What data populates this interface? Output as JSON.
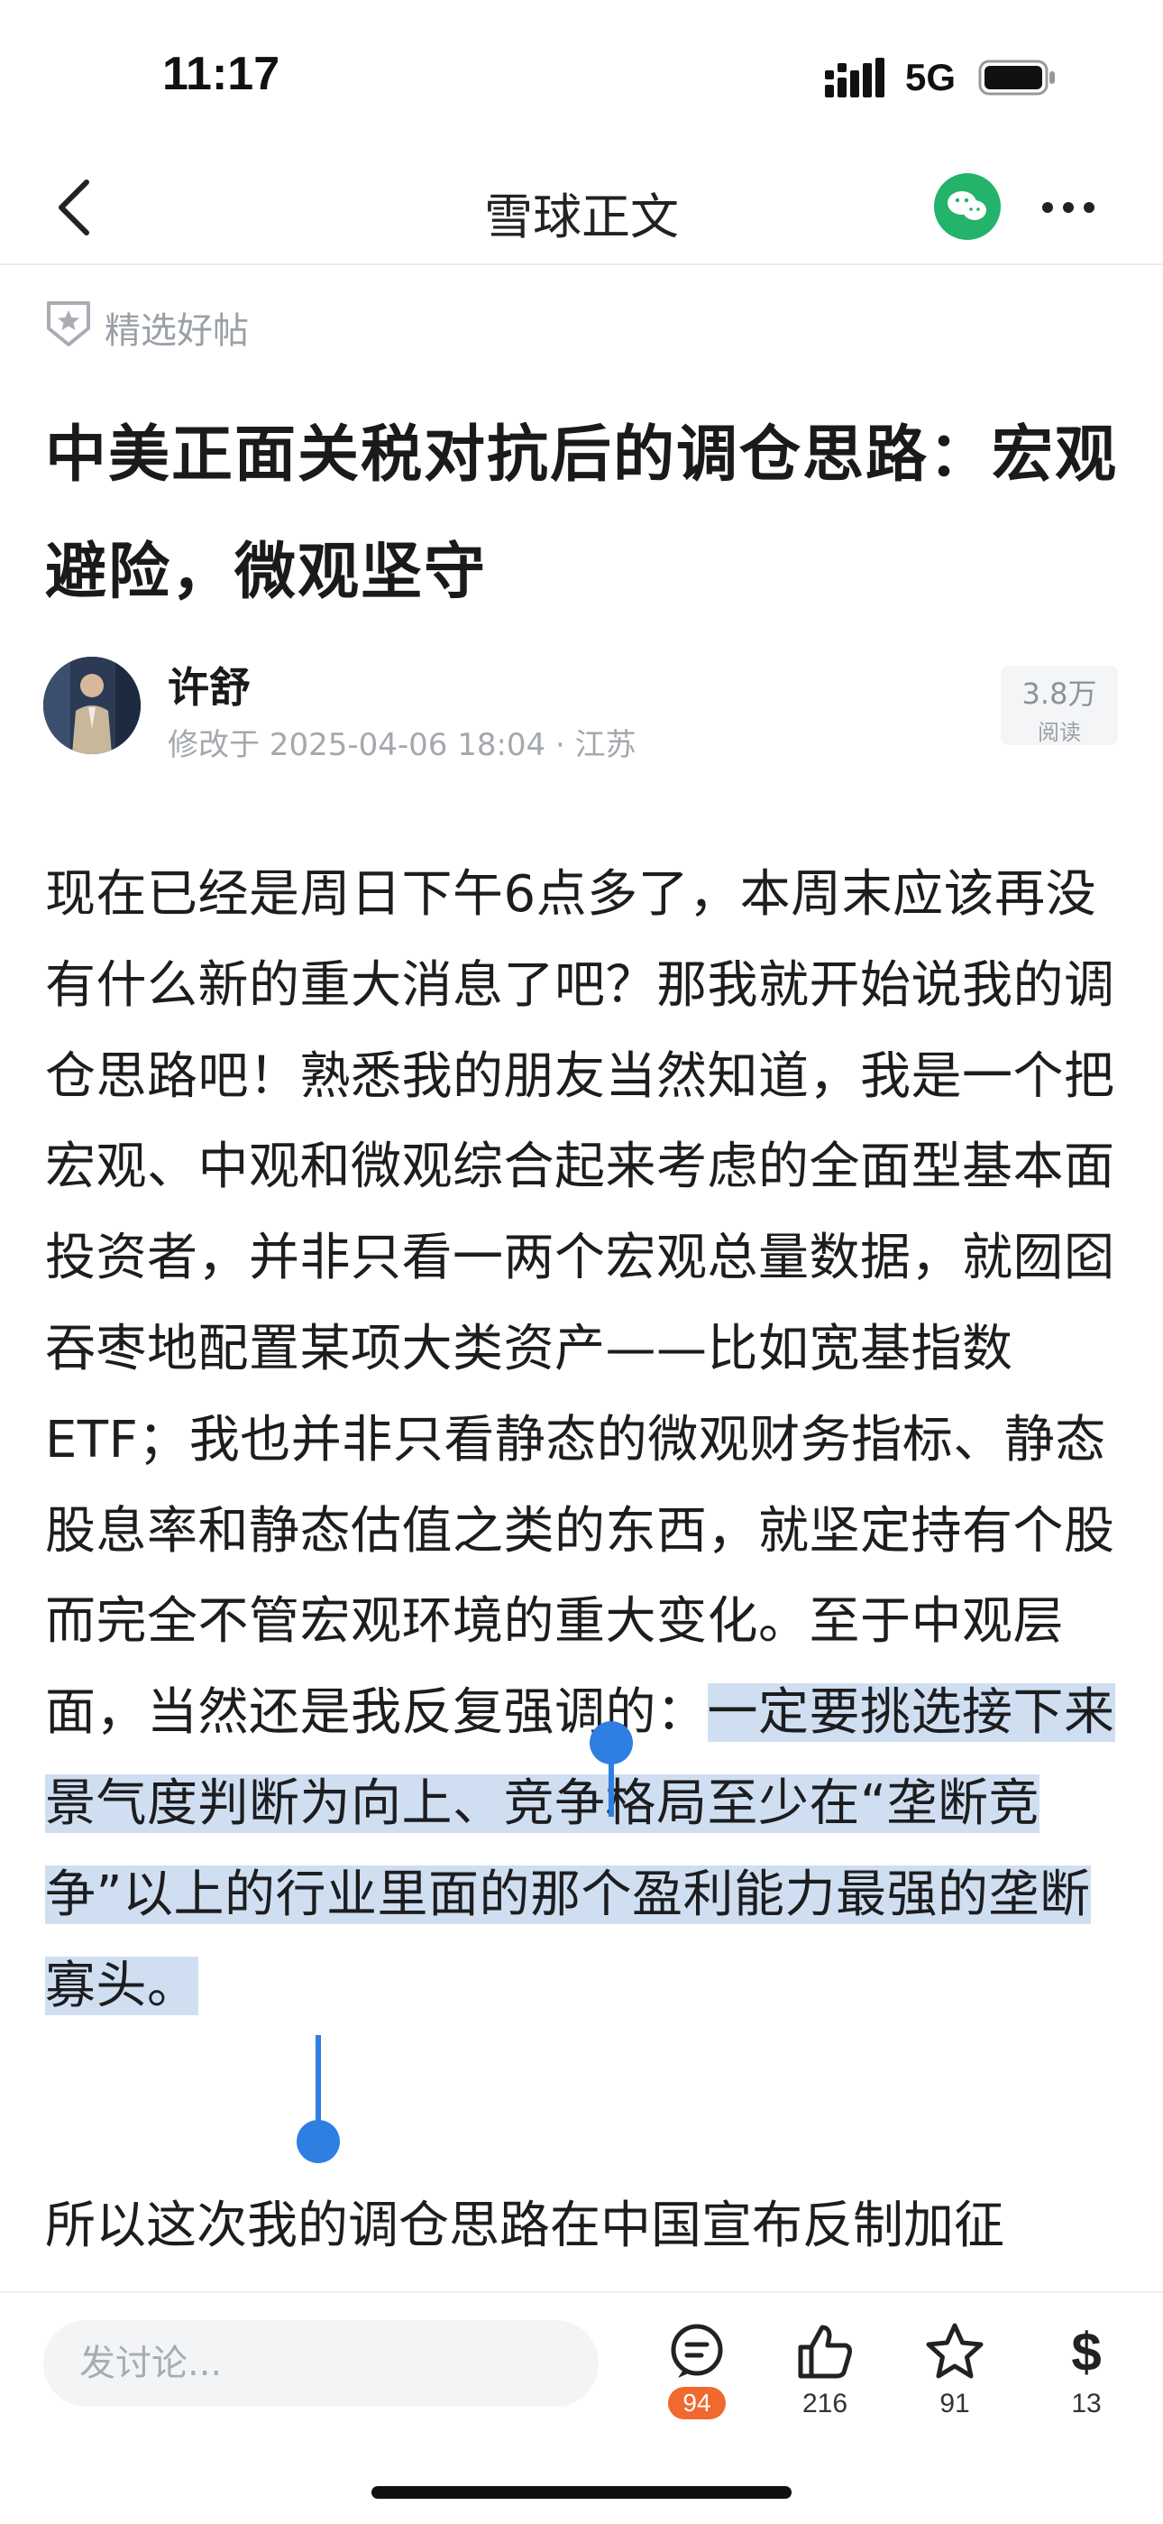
{
  "status_bar": {
    "time": "11:17",
    "network": "5G"
  },
  "nav": {
    "title": "雪球正文"
  },
  "badge": {
    "label": "精选好帖"
  },
  "article": {
    "title": "中美正面关税对抗后的调仓思路：宏观避险，微观坚守",
    "author": "许舒",
    "meta": "修改于 2025-04-06 18:04 · 江苏",
    "views_count": "3.8万",
    "views_label": "阅读",
    "paragraph1_plain": "现在已经是周日下午6点多了，本周末应该再没有什么新的重大消息了吧？那我就开始说我的调仓思路吧！熟悉我的朋友当然知道，我是一个把宏观、中观和微观综合起来考虑的全面型基本面投资者，并非只看一两个宏观总量数据，就囫囵吞枣地配置某项大类资产——比如宽基指数ETF；我也并非只看静态的微观财务指标、静态股息率和静态估值之类的东西，就坚定持有个股而完全不管宏观环境的重大变化。至于中观层面，当然还是我反复强调的：",
    "paragraph1_selected": "一定要挑选接下来景气度判断为向上、竞争格局至少在“垄断竞争”以上的行业里面的那个盈利能力最强的垄断寡头。",
    "paragraph2": "所以这次我的调仓思路在中国宣布反制加征"
  },
  "bottom": {
    "comment_placeholder": "发讨论...",
    "comments": "94",
    "likes": "216",
    "favorites": "91",
    "rewards": "13"
  },
  "colors": {
    "selection": "#cfdff1",
    "selection_handle": "#2f7ee2",
    "wechat": "#23b36b",
    "comment_badge": "#f0692f"
  },
  "icons": [
    "back-icon",
    "wechat-icon",
    "more-icon",
    "shield-star-icon",
    "comment-icon",
    "thumb-up-icon",
    "star-icon",
    "dollar-icon"
  ]
}
